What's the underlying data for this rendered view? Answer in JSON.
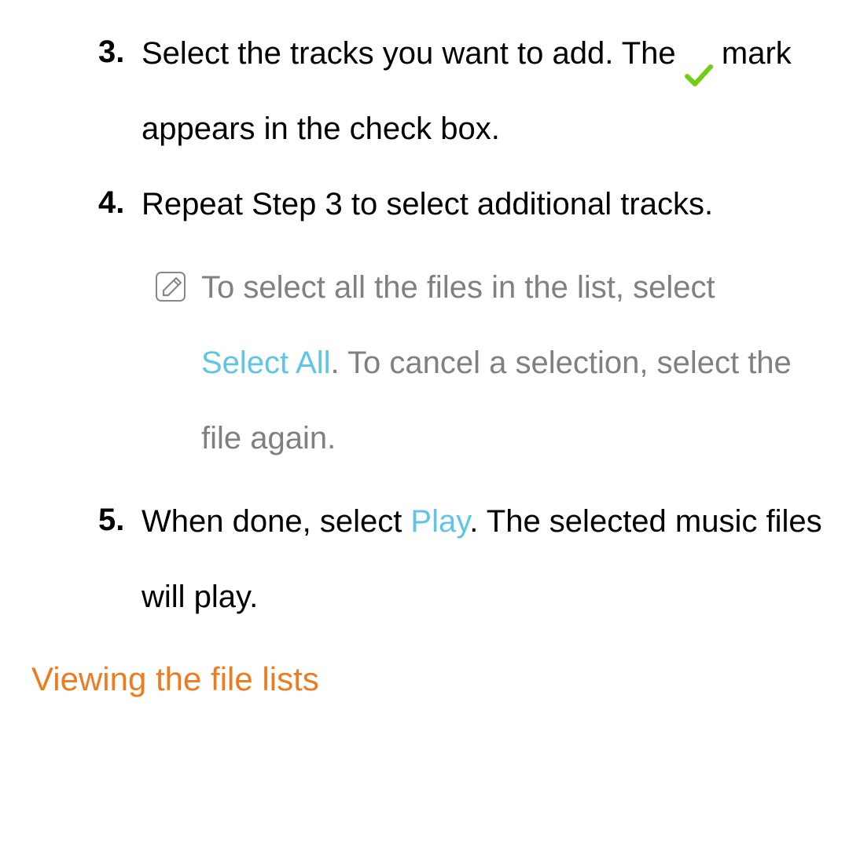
{
  "steps": {
    "step3": {
      "number": "3.",
      "text_before_check": "Select the tracks you want to add. The ",
      "text_after_check": " mark appears in the check box."
    },
    "step4": {
      "number": "4.",
      "text": "Repeat Step 3 to select additional tracks."
    },
    "note": {
      "text_part1": "To select all the files in the list, select ",
      "select_all": "Select All",
      "text_part2": ". To cancel a selection, select the file again."
    },
    "step5": {
      "number": "5.",
      "text_part1": "When done, select ",
      "play": "Play",
      "text_part2": ". The selected music files will play."
    }
  },
  "heading": "Viewing the file lists"
}
